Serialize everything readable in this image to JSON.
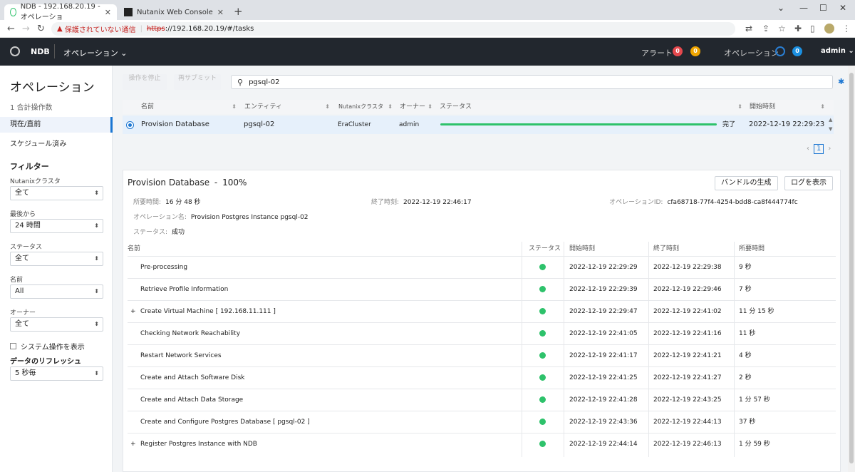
{
  "browser": {
    "tab1": "NDB - 192.168.20.19 - オペレーショ",
    "tab2": "Nutanix Web Console",
    "warning": "保護されていない通信",
    "url_https": "https",
    "url_rest": "://192.168.20.19/#/tasks"
  },
  "topbar": {
    "brand": "NDB",
    "menu": "オペレーション",
    "alerts_label": "アラート",
    "alert_count1": "0",
    "alert_count2": "0",
    "ops_label": "オペレーション",
    "ops_count": "0",
    "user": "admin"
  },
  "sidebar": {
    "title": "オペレーション",
    "count": "1 合計操作数",
    "current": "現在/直前",
    "scheduled": "スケジュール済み",
    "filter_title": "フィルター",
    "f1_label": "Nutanixクラスタ",
    "f1_value": "全て",
    "f2_label": "最後から",
    "f2_value": "24 時間",
    "f3_label": "ステータス",
    "f3_value": "全て",
    "f4_label": "名前",
    "f4_value": "All",
    "f5_label": "オーナー",
    "f5_value": "全て",
    "system_ops": "システム操作を表示",
    "refresh_label": "データのリフレッシュ",
    "refresh_value": "5 秒毎"
  },
  "toolbar": {
    "stop": "操作を停止",
    "resubmit": "再サブミット",
    "search_value": "pgsql-02"
  },
  "ops_table": {
    "headers": [
      "名前",
      "エンティティ",
      "Nutanixクラスタ",
      "オーナー",
      "ステータス",
      "開始時刻"
    ],
    "row": {
      "name": "Provision Database",
      "entity": "pgsql-02",
      "cluster": "EraCluster",
      "owner": "admin",
      "status": "完了",
      "progress": 100,
      "start": "2022-12-19 22:29:23"
    },
    "page": "1"
  },
  "detail": {
    "title": "Provision Database",
    "sep": "-",
    "pct": "100%",
    "bundle_btn": "バンドルの生成",
    "log_btn": "ログを表示",
    "duration_label": "所要時間:",
    "duration": "16 分 48 秒",
    "end_label": "終了時刻:",
    "end": "2022-12-19 22:46:17",
    "opid_label": "オペレーションID:",
    "opid": "cfa68718-77f4-4254-bdd8-ca8f444774fc",
    "opname_label": "オペレーション名:",
    "opname": "Provision Postgres Instance pgsql-02",
    "status_label": "ステータス:",
    "status": "成功",
    "headers": [
      "名前",
      "ステータス",
      "開始時刻",
      "終了時刻",
      "所要時間"
    ],
    "steps": [
      {
        "expand": "",
        "name": "Pre-processing",
        "start": "2022-12-19 22:29:29",
        "end": "2022-12-19 22:29:38",
        "dur": "9 秒"
      },
      {
        "expand": "",
        "name": "Retrieve Profile Information",
        "start": "2022-12-19 22:29:39",
        "end": "2022-12-19 22:29:46",
        "dur": "7 秒"
      },
      {
        "expand": "+",
        "name": "Create Virtual Machine [ 192.168.11.111 ]",
        "start": "2022-12-19 22:29:47",
        "end": "2022-12-19 22:41:02",
        "dur": "11 分 15 秒"
      },
      {
        "expand": "",
        "name": "Checking Network Reachability",
        "start": "2022-12-19 22:41:05",
        "end": "2022-12-19 22:41:16",
        "dur": "11 秒"
      },
      {
        "expand": "",
        "name": "Restart Network Services",
        "start": "2022-12-19 22:41:17",
        "end": "2022-12-19 22:41:21",
        "dur": "4 秒"
      },
      {
        "expand": "",
        "name": "Create and Attach Software Disk",
        "start": "2022-12-19 22:41:25",
        "end": "2022-12-19 22:41:27",
        "dur": "2 秒"
      },
      {
        "expand": "",
        "name": "Create and Attach Data Storage",
        "start": "2022-12-19 22:41:28",
        "end": "2022-12-19 22:43:25",
        "dur": "1 分 57 秒"
      },
      {
        "expand": "",
        "name": "Create and Configure Postgres Database [ pgsql-02 ]",
        "start": "2022-12-19 22:43:36",
        "end": "2022-12-19 22:44:13",
        "dur": "37 秒"
      },
      {
        "expand": "+",
        "name": "Register Postgres Instance with NDB",
        "start": "2022-12-19 22:44:14",
        "end": "2022-12-19 22:46:13",
        "dur": "1 分 59 秒"
      }
    ]
  }
}
